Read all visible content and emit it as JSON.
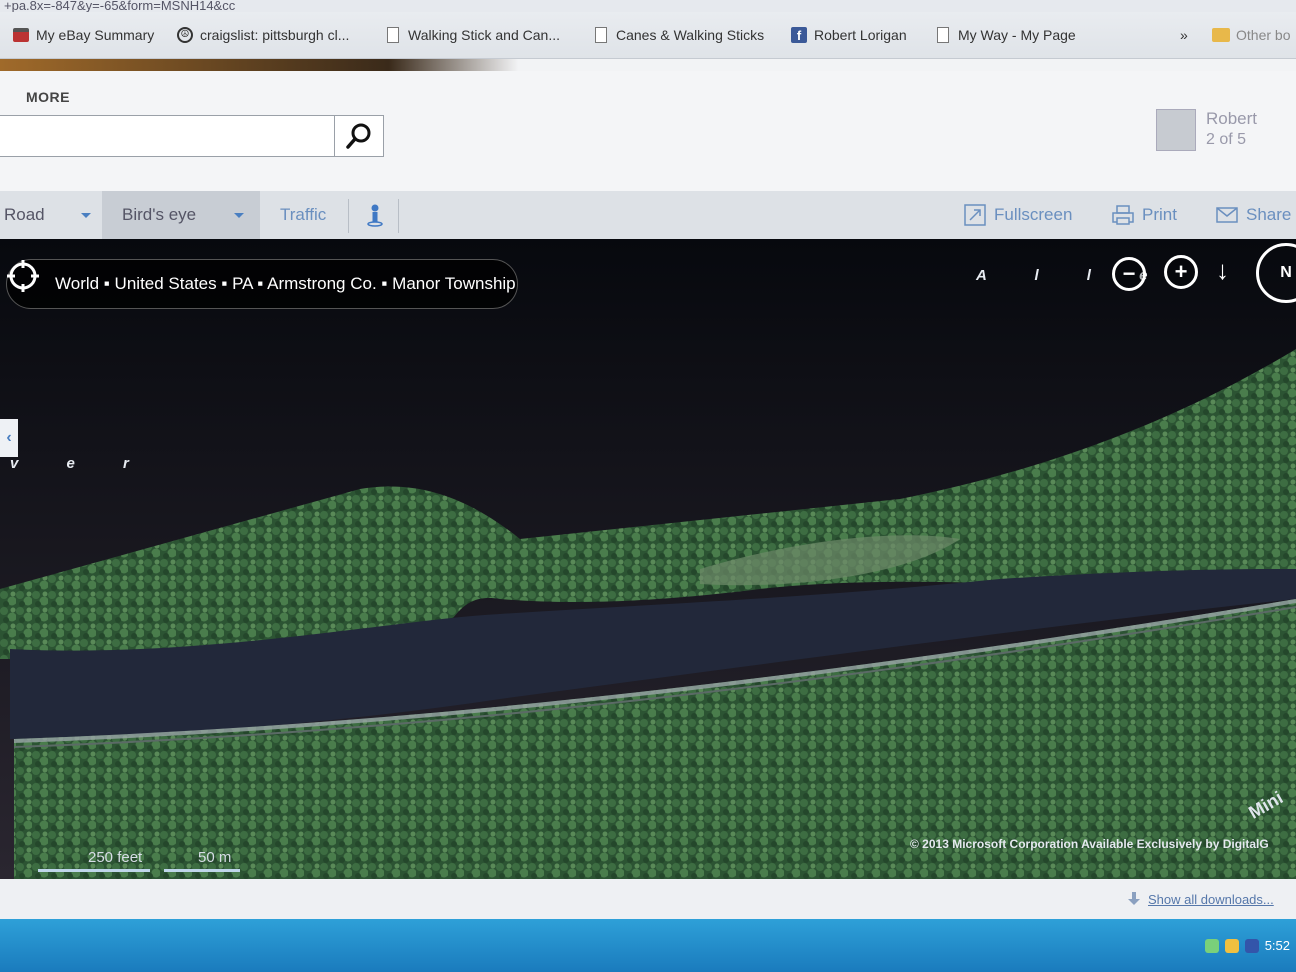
{
  "browser": {
    "url_fragment": "+pa.8x=-847&y=-65&form=MSNH14&cc",
    "bookmarks": [
      {
        "label": "My eBay Summary",
        "icon": "shopping-bag-icon"
      },
      {
        "label": "craigslist: pittsburgh cl...",
        "icon": "peace-icon"
      },
      {
        "label": "Walking Stick and Can...",
        "icon": "page-icon"
      },
      {
        "label": "Canes & Walking Sticks",
        "icon": "page-icon"
      },
      {
        "label": "Robert Lorigan",
        "icon": "facebook-icon"
      },
      {
        "label": "My Way - My Page",
        "icon": "page-icon"
      }
    ],
    "overflow_chevron": "»",
    "other_bookmarks_label": "Other bo"
  },
  "header": {
    "more_label": "MORE",
    "search": {
      "value": "",
      "placeholder": ""
    },
    "user": {
      "name": "Robert",
      "sub": "2 of 5"
    }
  },
  "toolbar": {
    "tabs": [
      {
        "label": "Road"
      },
      {
        "label": "Bird's eye",
        "active": true
      },
      {
        "label": "Traffic"
      }
    ],
    "actions": [
      {
        "label": "Fullscreen",
        "icon": "fullscreen-icon"
      },
      {
        "label": "Print",
        "icon": "print-icon"
      },
      {
        "label": "Share",
        "icon": "mail-icon"
      }
    ]
  },
  "map": {
    "breadcrumb": "World ▪ United States ▪ PA ▪ Armstrong Co. ▪ Manor Township",
    "river_label_top": "A l l e",
    "river_label_left": "v e r",
    "zoom_out": "−",
    "zoom_in": "+",
    "rotate": "↓",
    "compass": "N",
    "scale": {
      "feet": "250 feet",
      "meters": "50 m"
    },
    "copyright": "© 2013 Microsoft Corporation   Available Exclusively by DigitalG",
    "corner_label": "Mini",
    "colors": {
      "water": "#1b2230",
      "forest": "#2f5a34",
      "road": "#9aa4a8"
    }
  },
  "downloads": {
    "label": "Show all downloads..."
  },
  "taskbar": {
    "clock": "5:52"
  }
}
